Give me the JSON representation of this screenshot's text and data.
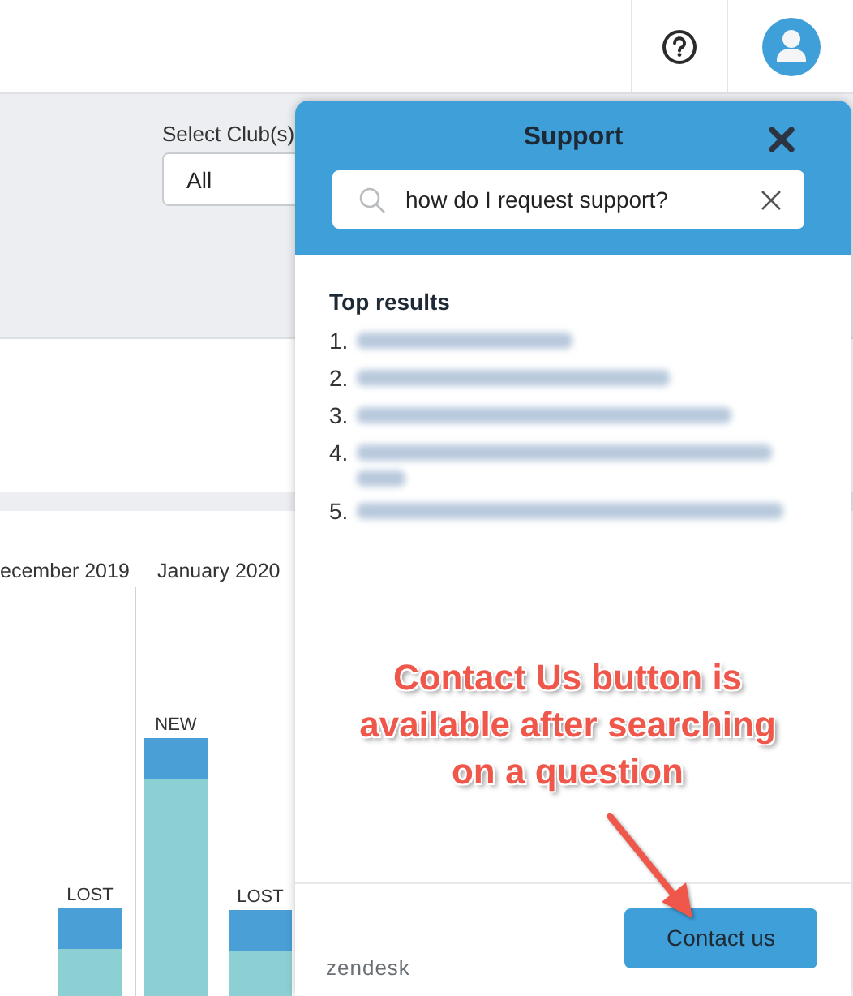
{
  "filters": {
    "club_label": "Select Club(s)",
    "club_value": "All"
  },
  "chart": {
    "months": [
      {
        "label": "ecember 2019",
        "bars": [
          {
            "label": "LOST"
          }
        ]
      },
      {
        "label": "January 2020",
        "bars": [
          {
            "label": "NEW"
          },
          {
            "label": "LOST"
          }
        ]
      }
    ]
  },
  "support": {
    "title": "Support",
    "search": {
      "value": "how do I request support?"
    },
    "results_heading": "Top results",
    "results": [
      {
        "number": "1."
      },
      {
        "number": "2."
      },
      {
        "number": "3."
      },
      {
        "number": "4."
      },
      {
        "number": "5."
      }
    ],
    "brand": "zendesk",
    "contact_button": "Contact us"
  },
  "annotation": {
    "text": "Contact Us button is\navailable after searching\non a question"
  }
}
